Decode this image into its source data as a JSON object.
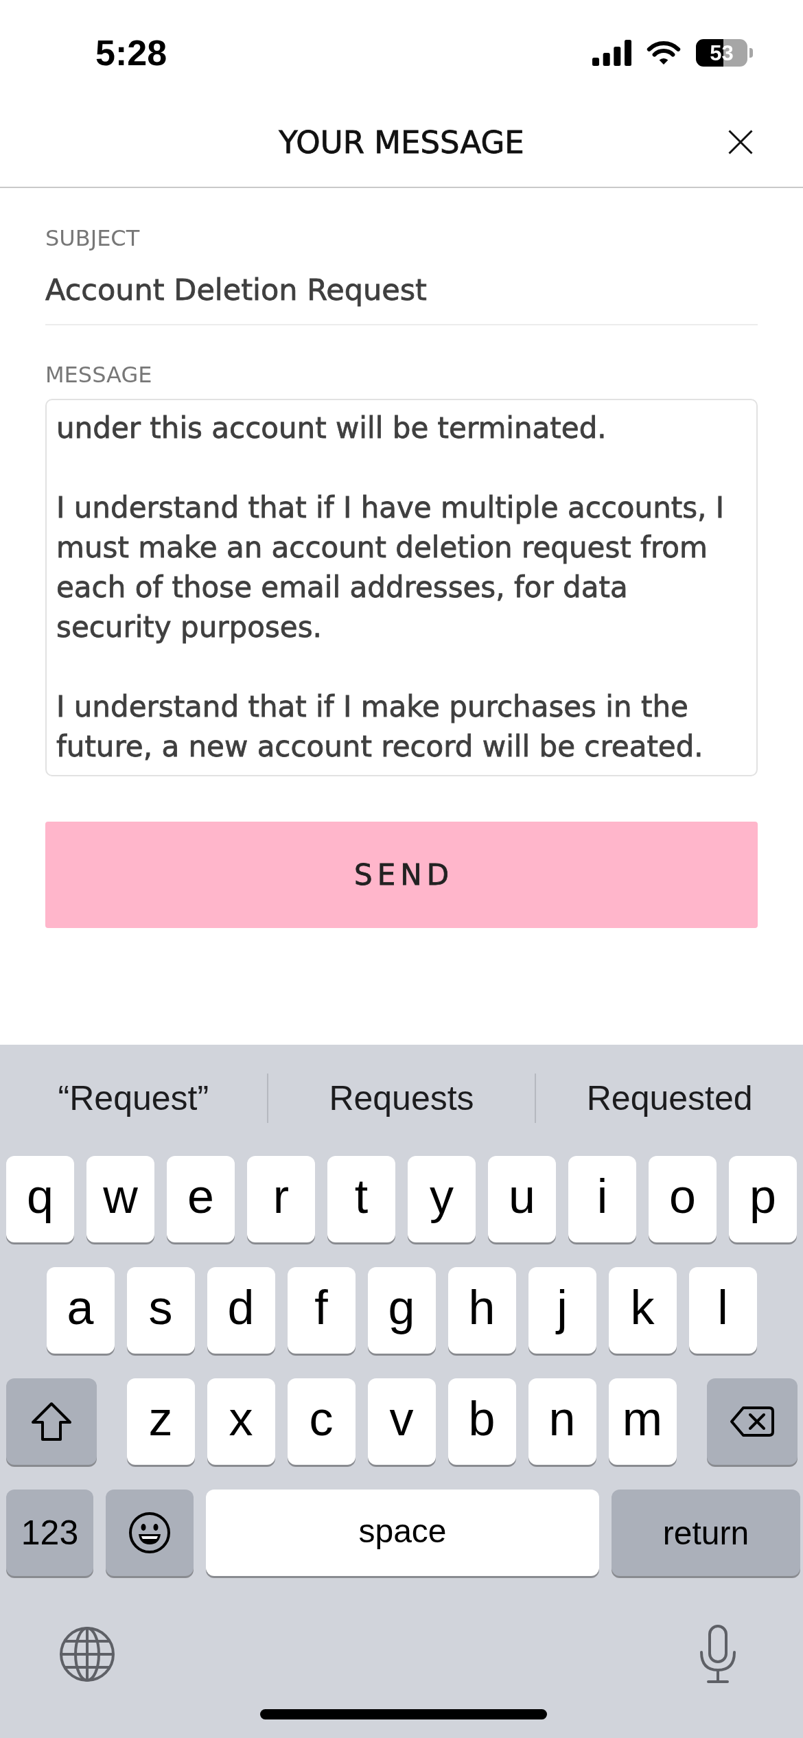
{
  "status_bar": {
    "time": "5:28",
    "battery": "53"
  },
  "header": {
    "title": "YOUR MESSAGE"
  },
  "form": {
    "fields": [
      {
        "kind": "line",
        "label": "SUBJECT",
        "value": "Account Deletion Request"
      },
      {
        "kind": "area",
        "label": "MESSAGE",
        "value": "under this account will be terminated.\n\nI understand that if I have multiple accounts, I must make an account deletion request from each of those email addresses, for data security purposes.\n\nI understand that if I make purchases in the future, a new account record will be created."
      }
    ]
  },
  "send_button": {
    "label": "SEND"
  },
  "keyboard": {
    "suggestions": [
      "“Request”",
      "Requests",
      "Requested"
    ],
    "rows": [
      {
        "keys": [
          {
            "kind": "letter",
            "label": "q"
          },
          {
            "kind": "letter",
            "label": "w"
          },
          {
            "kind": "letter",
            "label": "e"
          },
          {
            "kind": "letter",
            "label": "r"
          },
          {
            "kind": "letter",
            "label": "t"
          },
          {
            "kind": "letter",
            "label": "y"
          },
          {
            "kind": "letter",
            "label": "u"
          },
          {
            "kind": "letter",
            "label": "i"
          },
          {
            "kind": "letter",
            "label": "o"
          },
          {
            "kind": "letter",
            "label": "p"
          }
        ]
      },
      {
        "keys": [
          {
            "kind": "letter",
            "label": "a"
          },
          {
            "kind": "letter",
            "label": "s"
          },
          {
            "kind": "letter",
            "label": "d"
          },
          {
            "kind": "letter",
            "label": "f"
          },
          {
            "kind": "letter",
            "label": "g"
          },
          {
            "kind": "letter",
            "label": "h"
          },
          {
            "kind": "letter",
            "label": "j"
          },
          {
            "kind": "letter",
            "label": "k"
          },
          {
            "kind": "letter",
            "label": "l"
          }
        ]
      },
      {
        "keys": [
          {
            "kind": "shift"
          },
          {
            "kind": "letter",
            "label": "z"
          },
          {
            "kind": "letter",
            "label": "x"
          },
          {
            "kind": "letter",
            "label": "c"
          },
          {
            "kind": "letter",
            "label": "v"
          },
          {
            "kind": "letter",
            "label": "b"
          },
          {
            "kind": "letter",
            "label": "n"
          },
          {
            "kind": "letter",
            "label": "m"
          },
          {
            "kind": "delete"
          }
        ]
      },
      {
        "keys": [
          {
            "kind": "numbers",
            "label": "123"
          },
          {
            "kind": "emoji"
          },
          {
            "kind": "space",
            "label": "space"
          },
          {
            "kind": "return",
            "label": "return"
          }
        ]
      }
    ]
  }
}
